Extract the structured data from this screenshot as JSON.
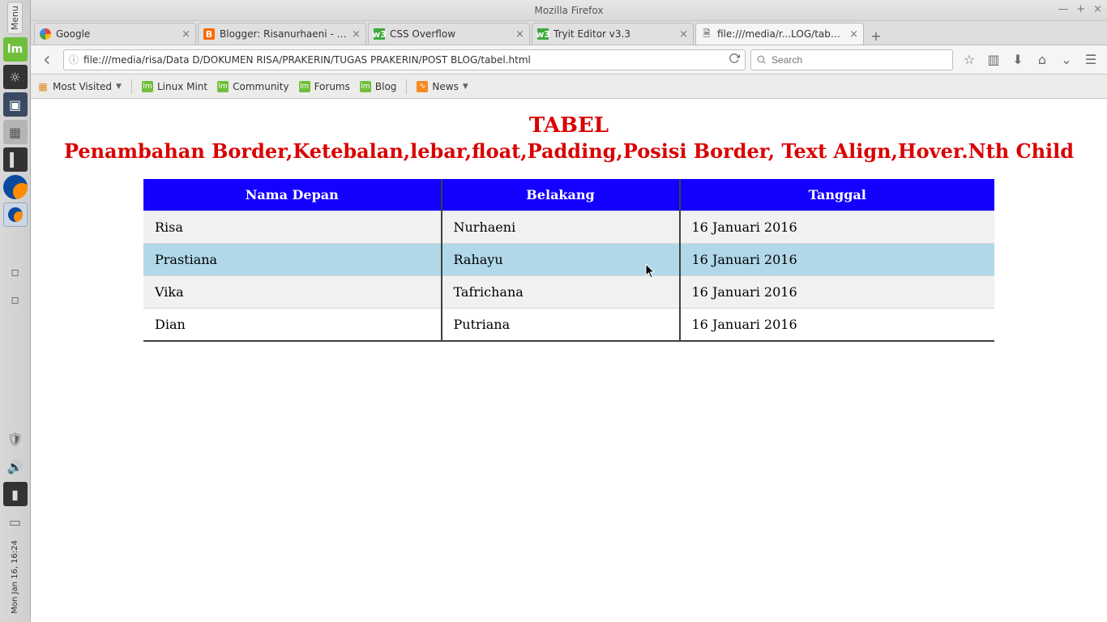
{
  "window": {
    "title": "Mozilla Firefox"
  },
  "winbtns": {
    "min": "—",
    "max": "+",
    "close": "×"
  },
  "syspanel": {
    "menu": "Menu",
    "datetime": "Mon Jan 16, 16:24"
  },
  "tabs": [
    {
      "label": "Google",
      "fav": "google"
    },
    {
      "label": "Blogger: Risanurhaeni - S...",
      "fav": "blogger"
    },
    {
      "label": "CSS Overflow",
      "fav": "w3"
    },
    {
      "label": "Tryit Editor v3.3",
      "fav": "w3"
    },
    {
      "label": "file:///media/r...LOG/tabel.html",
      "fav": "none",
      "active": true
    }
  ],
  "newtab": "+",
  "url": {
    "info_icon": "ⓘ",
    "path": "file:///media/risa/Data D/DOKUMEN RISA/PRAKERIN/TUGAS PRAKERIN/POST BLOG/tabel.html"
  },
  "search": {
    "placeholder": "Search"
  },
  "bookmarks": {
    "most_visited": "Most Visited",
    "items": [
      "Linux Mint",
      "Community",
      "Forums",
      "Blog"
    ],
    "news": "News"
  },
  "page": {
    "heading1": "TABEL",
    "heading2": "Penambahan Border,Ketebalan,lebar,float,Padding,Posisi Border, Text Align,Hover.Nth Child"
  },
  "table": {
    "headers": [
      "Nama Depan",
      "Belakang",
      "Tanggal"
    ],
    "rows": [
      {
        "c0": "Risa",
        "c1": "Nurhaeni",
        "c2": "16 Januari 2016"
      },
      {
        "c0": "Prastiana",
        "c1": "Rahayu",
        "c2": "16 Januari 2016",
        "hover": true
      },
      {
        "c0": "Vika",
        "c1": "Tafrichana",
        "c2": "16 Januari 2016"
      },
      {
        "c0": "Dian",
        "c1": "Putriana",
        "c2": "16 Januari 2016"
      }
    ]
  }
}
